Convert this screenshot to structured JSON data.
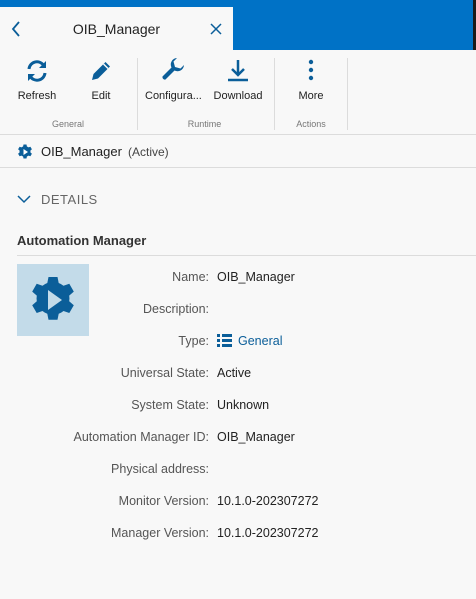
{
  "tab": {
    "title": "OIB_Manager"
  },
  "ribbon": {
    "buttons": {
      "refresh": "Refresh",
      "edit": "Edit",
      "configure": "Configura...",
      "download": "Download",
      "more": "More"
    },
    "groups": {
      "general": "General",
      "runtime": "Runtime",
      "actions": "Actions"
    }
  },
  "entity": {
    "name": "OIB_Manager",
    "status": "(Active)"
  },
  "details": {
    "header": "DETAILS",
    "section_title": "Automation Manager",
    "properties": [
      {
        "label": "Name:",
        "value": "OIB_Manager"
      },
      {
        "label": "Description:",
        "value": ""
      },
      {
        "label": "Type:",
        "value": "General"
      },
      {
        "label": "Universal State:",
        "value": "Active"
      },
      {
        "label": "System State:",
        "value": "Unknown"
      },
      {
        "label": "Automation Manager ID:",
        "value": "OIB_Manager"
      },
      {
        "label": "Physical address:",
        "value": ""
      },
      {
        "label": "Monitor Version:",
        "value": "10.1.0-202307272"
      },
      {
        "label": "Manager Version:",
        "value": "10.1.0-202307272"
      }
    ]
  },
  "colors": {
    "accent": "#0072c6",
    "icon_blue": "#0b5e99",
    "icon_bg": "#c3dbe9"
  },
  "icons": {
    "back": "chevron-left-icon",
    "close": "close-icon",
    "refresh": "refresh-icon",
    "edit": "pencil-icon",
    "configure": "wrench-icon",
    "download": "download-icon",
    "more": "more-vertical-icon",
    "entity": "gear-play-icon",
    "collapse": "chevron-down-icon",
    "type": "list-icon"
  }
}
